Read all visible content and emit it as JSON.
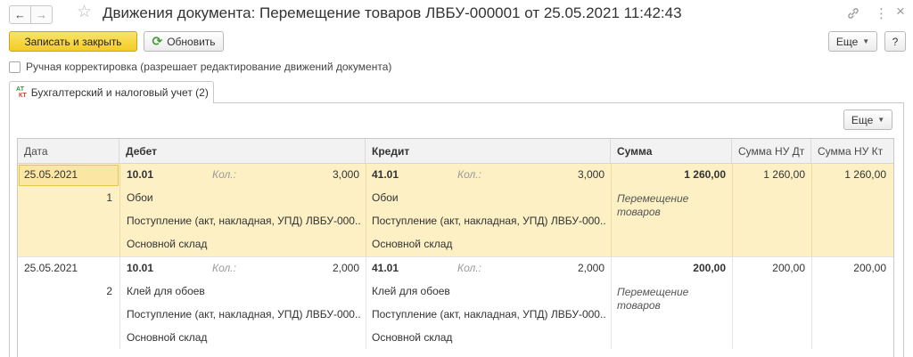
{
  "window": {
    "title": "Движения документа: Перемещение товаров ЛВБУ-000001 от 25.05.2021 11:42:43",
    "back_icon": "←",
    "forward_icon": "→",
    "star_icon": "☆",
    "link_icon": "🔗",
    "more_icon": "⋮",
    "close_icon": "×"
  },
  "toolbar": {
    "save_close_label": "Записать и закрыть",
    "refresh_icon": "⟳",
    "refresh_label": "Обновить",
    "more_label": "Еще",
    "help_label": "?"
  },
  "manual_edit": {
    "label": "Ручная корректировка (разрешает редактирование движений документа)",
    "checked": false
  },
  "tabs": [
    {
      "label": "Бухгалтерский и налоговый учет (2)",
      "icon_top": "АТ",
      "icon_bottom": "КТ"
    }
  ],
  "table_toolbar": {
    "more_label": "Еще"
  },
  "table": {
    "columns": [
      "Дата",
      "Дебет",
      "Кредит",
      "Сумма",
      "Сумма НУ Дт",
      "Сумма НУ Кт"
    ],
    "rows": [
      {
        "date": "25.05.2021",
        "line_no": "1",
        "debit_account": "10.01",
        "qty_label": "Кол.:",
        "debit_qty": "3,000",
        "debit_sub1": "Обои",
        "debit_sub2": "Поступление (акт, накладная, УПД) ЛВБУ-000...",
        "debit_sub3": "Основной склад",
        "credit_account": "41.01",
        "credit_qty": "3,000",
        "credit_sub1": "Обои",
        "credit_sub2": "Поступление (акт, накладная, УПД) ЛВБУ-000...",
        "credit_sub3": "Основной склад",
        "sum": "1 260,00",
        "content": "Перемещение товаров",
        "sum_nu_dt": "1 260,00",
        "sum_nu_kt": "1 260,00",
        "selected": true
      },
      {
        "date": "25.05.2021",
        "line_no": "2",
        "debit_account": "10.01",
        "qty_label": "Кол.:",
        "debit_qty": "2,000",
        "debit_sub1": "Клей для обоев",
        "debit_sub2": "Поступление (акт, накладная, УПД) ЛВБУ-000...",
        "debit_sub3": "Основной склад",
        "credit_account": "41.01",
        "credit_qty": "2,000",
        "credit_sub1": "Клей для обоев",
        "credit_sub2": "Поступление (акт, накладная, УПД) ЛВБУ-000...",
        "credit_sub3": "Основной склад",
        "sum": "200,00",
        "content": "Перемещение товаров",
        "sum_nu_dt": "200,00",
        "sum_nu_kt": "200,00",
        "selected": false
      }
    ]
  }
}
